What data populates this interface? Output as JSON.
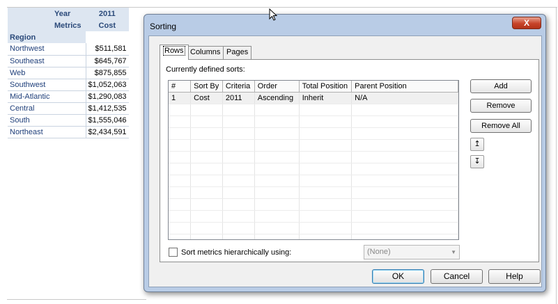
{
  "report": {
    "header": {
      "year_label": "Year",
      "year_value": "2011",
      "metrics_label": "Metrics",
      "metric_value": "Cost",
      "region_label": "Region"
    },
    "rows": [
      {
        "region": "Northwest",
        "cost": "$511,581"
      },
      {
        "region": "Southeast",
        "cost": "$645,767"
      },
      {
        "region": "Web",
        "cost": "$875,855"
      },
      {
        "region": "Southwest",
        "cost": "$1,052,063"
      },
      {
        "region": "Mid-Atlantic",
        "cost": "$1,290,083"
      },
      {
        "region": "Central",
        "cost": "$1,412,535"
      },
      {
        "region": "South",
        "cost": "$1,555,046"
      },
      {
        "region": "Northeast",
        "cost": "$2,434,591"
      }
    ]
  },
  "dialog": {
    "title": "Sorting",
    "close_label": "X",
    "tabs": [
      {
        "label": "Rows"
      },
      {
        "label": "Columns"
      },
      {
        "label": "Pages"
      }
    ],
    "section_label": "Currently defined sorts:",
    "columns": [
      "#",
      "Sort By",
      "Criteria",
      "Order",
      "Total Position",
      "Parent Position"
    ],
    "sorts": [
      {
        "num": "1",
        "sort_by": "Cost",
        "criteria": "2011",
        "order": "Ascending",
        "total_position": "Inherit",
        "parent_position": "N/A"
      }
    ],
    "buttons": {
      "add": "Add",
      "remove": "Remove",
      "remove_all": "Remove All",
      "move_up": "↥",
      "move_down": "↧"
    },
    "hierarchical_label": "Sort metrics hierarchically using:",
    "hierarchical_checked": false,
    "hierarchical_select": "(None)",
    "footer": {
      "ok": "OK",
      "cancel": "Cancel",
      "help": "Help"
    }
  }
}
